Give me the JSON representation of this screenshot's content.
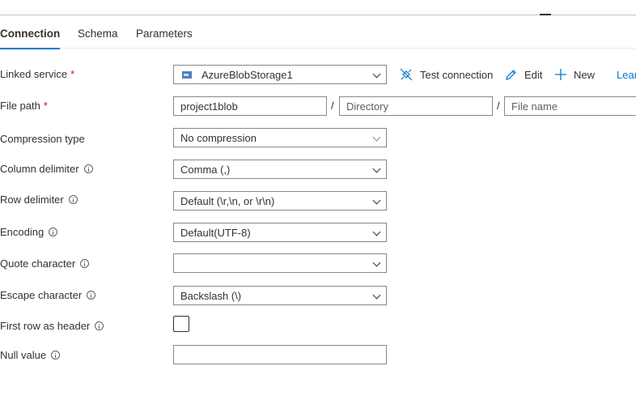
{
  "tabs": [
    {
      "label": "Connection",
      "active": true
    },
    {
      "label": "Schema",
      "active": false
    },
    {
      "label": "Parameters",
      "active": false
    }
  ],
  "form": {
    "linked_service": {
      "label": "Linked service",
      "required": true,
      "value": "AzureBlobStorage1",
      "icon": "blob-storage-icon"
    },
    "file_path": {
      "label": "File path",
      "required": true,
      "container": "project1blob",
      "directory_placeholder": "Directory",
      "file_placeholder": "File name",
      "separator": "/"
    },
    "compression_type": {
      "label": "Compression type",
      "value": "No compression"
    },
    "column_delimiter": {
      "label": "Column delimiter",
      "value": "Comma (,)"
    },
    "row_delimiter": {
      "label": "Row delimiter",
      "value": "Default (\\r,\\n, or \\r\\n)"
    },
    "encoding": {
      "label": "Encoding",
      "value": "Default(UTF-8)"
    },
    "quote_character": {
      "label": "Quote character",
      "value": ""
    },
    "escape_character": {
      "label": "Escape character",
      "value": "Backslash (\\)"
    },
    "first_row_header": {
      "label": "First row as header",
      "checked": false
    },
    "null_value": {
      "label": "Null value",
      "value": ""
    }
  },
  "actions": {
    "test_connection": "Test connection",
    "edit": "Edit",
    "new": "New",
    "learn": "Lear"
  },
  "required_marker": "*",
  "colors": {
    "accent": "#0078d4",
    "required": "#a4262c",
    "border": "#8a8886"
  }
}
